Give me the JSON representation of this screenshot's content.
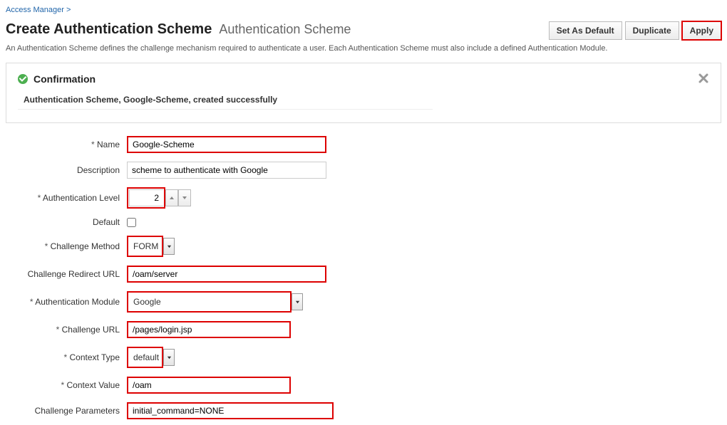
{
  "breadcrumb": {
    "link": "Access Manager",
    "sep": ">"
  },
  "header": {
    "title": "Create Authentication Scheme",
    "subtitle": "Authentication Scheme",
    "buttons": {
      "set_default": "Set As Default",
      "duplicate": "Duplicate",
      "apply": "Apply"
    },
    "desc": "An Authentication Scheme defines the challenge mechanism required to authenticate a user. Each Authentication Scheme must also include a defined Authentication Module."
  },
  "confirmation": {
    "title": "Confirmation",
    "msg": "Authentication Scheme, Google-Scheme, created successfully"
  },
  "form": {
    "labels": {
      "name": "Name",
      "description": "Description",
      "auth_level": "Authentication Level",
      "default": "Default",
      "challenge_method": "Challenge Method",
      "challenge_redirect_url": "Challenge Redirect URL",
      "auth_module": "Authentication Module",
      "challenge_url": "Challenge URL",
      "context_type": "Context Type",
      "context_value": "Context Value",
      "challenge_params": "Challenge Parameters"
    },
    "values": {
      "name": "Google-Scheme",
      "description": "scheme to authenticate with Google",
      "auth_level": "2",
      "default": false,
      "challenge_method": "FORM",
      "challenge_redirect_url": "/oam/server",
      "auth_module": "Google",
      "challenge_url": "/pages/login.jsp",
      "context_type": "default",
      "context_value": "/oam",
      "challenge_params": "initial_command=NONE"
    }
  }
}
